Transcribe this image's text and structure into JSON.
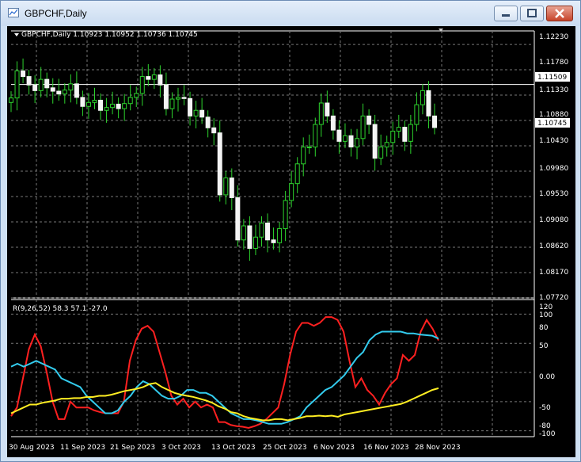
{
  "window": {
    "title": "GBPCHF,Daily"
  },
  "main": {
    "header": "GBPCHF,Daily  1.10923 1.10952 1.10736 1.10745",
    "y_ticks": [
      "1.12230",
      "1.11780",
      "1.11330",
      "1.10880",
      "1.10430",
      "1.09980",
      "1.09530",
      "1.09080",
      "1.08620",
      "1.08170",
      "1.07720"
    ],
    "price_labels": [
      "1.11509",
      "1.10745"
    ]
  },
  "indicator": {
    "header": "R(9,26,52) 58.3 57.1 -27.0",
    "y_ticks": [
      "120",
      "100",
      "80",
      "50",
      "0.00",
      "-50",
      "-80",
      "-100"
    ]
  },
  "x_ticks": [
    "30 Aug 2023",
    "11 Sep 2023",
    "21 Sep 2023",
    "3 Oct 2023",
    "13 Oct 2023",
    "25 Oct 2023",
    "6 Nov 2023",
    "16 Nov 2023",
    "28 Nov 2023"
  ],
  "chart_data": {
    "type": "line",
    "price_panel": {
      "symbol": "GBPCHF",
      "timeframe": "Daily",
      "ylim": [
        1.0772,
        1.1246
      ],
      "ohlc": [
        1.10923,
        1.10952,
        1.10736,
        1.10745
      ],
      "close_series": [
        1.1127,
        1.1175,
        1.1165,
        1.115,
        1.114,
        1.116,
        1.1145,
        1.1139,
        1.1134,
        1.1141,
        1.1152,
        1.1128,
        1.1112,
        1.1119,
        1.1123,
        1.1105,
        1.111,
        1.1116,
        1.1108,
        1.1117,
        1.1128,
        1.1135,
        1.1165,
        1.116,
        1.1168,
        1.115,
        1.1108,
        1.1125,
        1.1128,
        1.1126,
        1.1095,
        1.1105,
        1.1093,
        1.1074,
        1.1065,
        1.0955,
        1.0985,
        1.095,
        1.0875,
        1.09,
        1.086,
        1.088,
        1.0905,
        1.0875,
        1.087,
        1.0895,
        1.0945,
        1.0975,
        1.101,
        1.104,
        1.104,
        1.108,
        1.1118,
        1.1095,
        1.107,
        1.105,
        1.106,
        1.104,
        1.1055,
        1.1095,
        1.108,
        1.102,
        1.104,
        1.1048,
        1.1068,
        1.1075,
        1.105,
        1.108,
        1.1115,
        1.114,
        1.1095,
        1.10745
      ],
      "horizontal_line": 1.11509
    },
    "indicator_panel": {
      "name": "R(9,26,52)",
      "ylim": [
        -110,
        125
      ],
      "series": [
        {
          "color": "#ff2020",
          "values": [
            -75,
            -60,
            -10,
            40,
            65,
            45,
            0,
            -50,
            -80,
            -80,
            -50,
            -60,
            -60,
            -60,
            -65,
            -68,
            -70,
            -70,
            -70,
            -50,
            20,
            55,
            75,
            80,
            70,
            35,
            0,
            -40,
            -55,
            -45,
            -60,
            -50,
            -60,
            -55,
            -60,
            -85,
            -85,
            -90,
            -92,
            -93,
            -95,
            -92,
            -88,
            -80,
            -70,
            -60,
            -20,
            30,
            70,
            85,
            85,
            80,
            85,
            95,
            95,
            90,
            70,
            20,
            -25,
            -10,
            -30,
            -40,
            -55,
            -35,
            -20,
            -10,
            30,
            20,
            30,
            70,
            90,
            75,
            55
          ]
        },
        {
          "color": "#33ccee",
          "values": [
            10,
            15,
            10,
            15,
            20,
            15,
            10,
            5,
            -10,
            -15,
            -20,
            -25,
            -40,
            -50,
            -60,
            -70,
            -70,
            -65,
            -50,
            -40,
            -25,
            -15,
            -20,
            -30,
            -40,
            -45,
            -45,
            -40,
            -30,
            -30,
            -35,
            -35,
            -40,
            -50,
            -60,
            -70,
            -75,
            -80,
            -80,
            -82,
            -85,
            -88,
            -88,
            -88,
            -85,
            -80,
            -75,
            -60,
            -50,
            -40,
            -30,
            -25,
            -15,
            -5,
            10,
            25,
            35,
            55,
            65,
            70,
            70,
            70,
            70,
            67,
            67,
            65,
            64,
            63,
            58
          ]
        },
        {
          "color": "#ffee22",
          "values": [
            -70,
            -65,
            -60,
            -55,
            -55,
            -52,
            -50,
            -48,
            -45,
            -45,
            -44,
            -44,
            -42,
            -42,
            -40,
            -40,
            -38,
            -35,
            -32,
            -30,
            -28,
            -25,
            -20,
            -18,
            -25,
            -30,
            -35,
            -38,
            -40,
            -42,
            -45,
            -48,
            -52,
            -58,
            -62,
            -68,
            -70,
            -75,
            -78,
            -80,
            -82,
            -82,
            -80,
            -80,
            -82,
            -80,
            -78,
            -75,
            -75,
            -74,
            -75,
            -74,
            -76,
            -72,
            -70,
            -68,
            -66,
            -64,
            -62,
            -60,
            -58,
            -56,
            -54,
            -50,
            -45,
            -40,
            -35,
            -30,
            -27
          ]
        }
      ]
    },
    "categories": [
      "30 Aug 2023",
      "11 Sep 2023",
      "21 Sep 2023",
      "3 Oct 2023",
      "13 Oct 2023",
      "25 Oct 2023",
      "6 Nov 2023",
      "16 Nov 2023",
      "28 Nov 2023"
    ]
  }
}
